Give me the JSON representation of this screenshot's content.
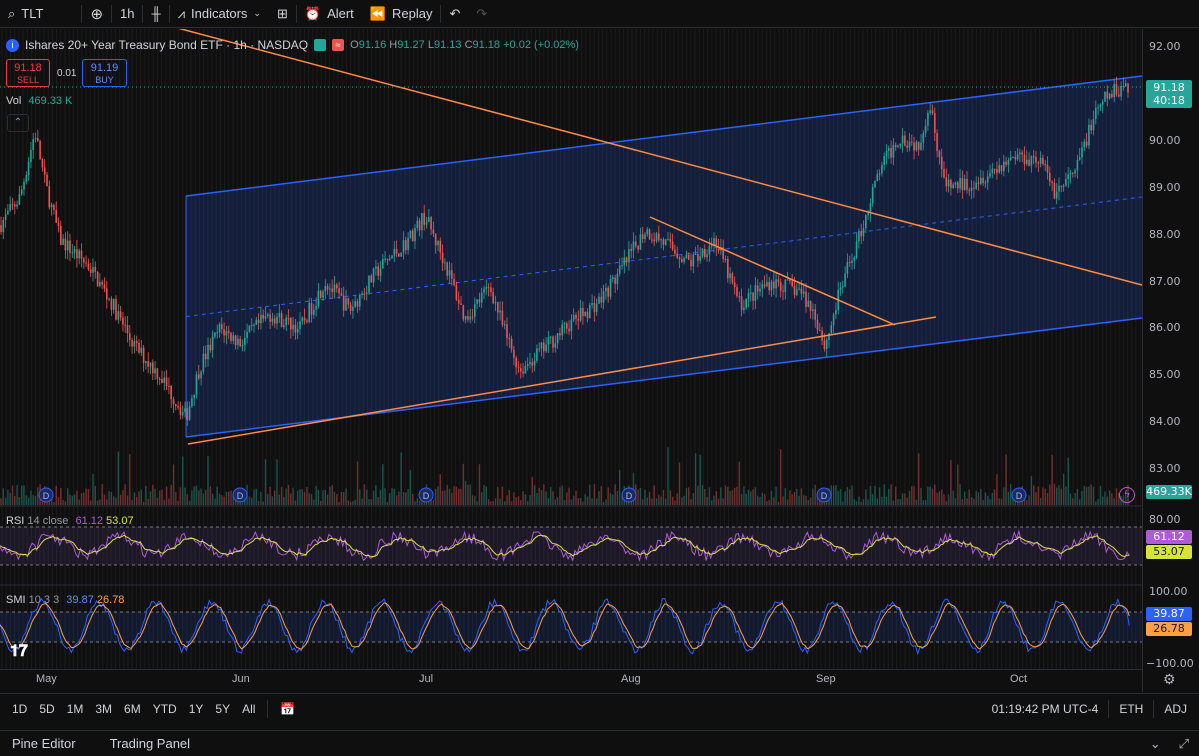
{
  "toolbar": {
    "symbol": "TLT",
    "interval": "1h",
    "indicators_label": "Indicators",
    "alert_label": "Alert",
    "replay_label": "Replay"
  },
  "legend": {
    "title": "Ishares 20+ Year Treasury Bond ETF · 1h · NASDAQ",
    "open_label": "O",
    "open": "91.16",
    "high_label": "H",
    "high": "91.27",
    "low_label": "L",
    "low": "91.13",
    "close_label": "C",
    "close": "91.18",
    "change": "+0.02 (+0.02%)"
  },
  "trade": {
    "sell_price": "91.18",
    "sell_label": "SELL",
    "spread": "0.01",
    "buy_price": "91.19",
    "buy_label": "BUY"
  },
  "volume": {
    "label": "Vol",
    "value": "469.33 K",
    "badge": "469.33K"
  },
  "price_axis": {
    "ticks": [
      "92.00",
      "91.00",
      "90.00",
      "89.00",
      "88.00",
      "87.00",
      "86.00",
      "85.00",
      "84.00",
      "83.00"
    ],
    "last_price": "91.18",
    "countdown": "40:18"
  },
  "rsi": {
    "label": "RSI",
    "params": "14 close",
    "value1": "61.12",
    "value2": "53.07",
    "axis_top": "80.00"
  },
  "smi": {
    "label": "SMI",
    "params": "10 3 3",
    "value1": "39.87",
    "value2": "26.78",
    "axis_top": "100.00",
    "axis_bottom": "−100.00"
  },
  "date_axis": [
    "May",
    "Jun",
    "Jul",
    "Aug",
    "Sep",
    "Oct"
  ],
  "dividend_marker": "D",
  "ranges": [
    "1D",
    "5D",
    "1M",
    "3M",
    "6M",
    "YTD",
    "1Y",
    "5Y",
    "All"
  ],
  "status": {
    "time": "01:19:42 PM UTC-4",
    "session": "ETH",
    "adj": "ADJ"
  },
  "footer": {
    "tab1": "Pine Editor",
    "tab2": "Trading Panel"
  },
  "colors": {
    "up": "#26a69a",
    "down": "#ef5350",
    "channel": "#2962ff",
    "trendline": "#ff8c42",
    "rsi": "#b05bd6",
    "rsi_signal": "#d7e635",
    "smi": "#2962ff",
    "smi_signal": "#ff9f43"
  }
}
